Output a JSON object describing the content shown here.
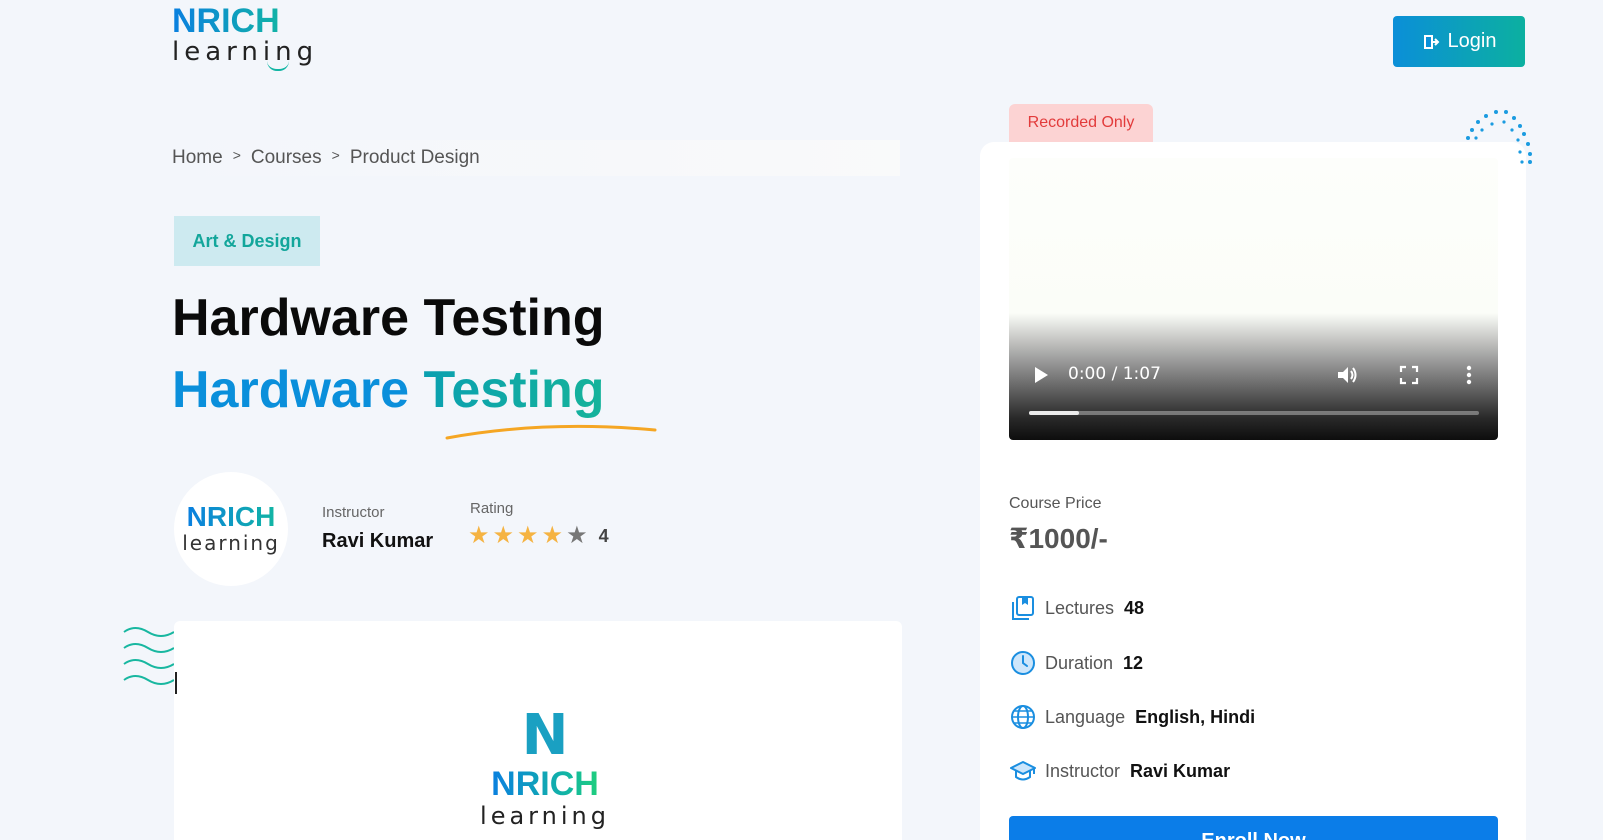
{
  "brand": {
    "logo_top": "NRICH",
    "logo_bottom": "learning"
  },
  "header": {
    "login_label": "Login"
  },
  "breadcrumb": {
    "items": [
      "Home",
      "Courses",
      "Product Design"
    ],
    "separator": ">"
  },
  "course": {
    "category": "Art & Design",
    "title_line_1": "Hardware Testing",
    "title_line_2_a": "Hardware",
    "title_line_2_b": "Testing",
    "instructor_label": "Instructor",
    "instructor_name": "Ravi Kumar",
    "rating_label": "Rating",
    "rating_value": "4",
    "rating_max": 5
  },
  "sidebar": {
    "tag": "Recorded Only",
    "video": {
      "time": "0:00 / 1:07",
      "progress": 0.11
    },
    "price_label": "Course Price",
    "price_value": "₹1000/-",
    "details": [
      {
        "icon": "book-icon",
        "label": "Lectures",
        "value": "48"
      },
      {
        "icon": "clock-icon",
        "label": "Duration",
        "value": "12"
      },
      {
        "icon": "globe-icon",
        "label": "Language",
        "value": "English, Hindi"
      },
      {
        "icon": "graduation-cap-icon",
        "label": "Instructor",
        "value": "Ravi Kumar"
      }
    ],
    "enroll_label": "Enroll Now"
  },
  "colors": {
    "accent_blue": "#0b7de8",
    "accent_teal": "#12b5a4",
    "star": "#f5b342",
    "tag_bg": "#fcd3d3",
    "tag_text": "#e23b3b"
  }
}
